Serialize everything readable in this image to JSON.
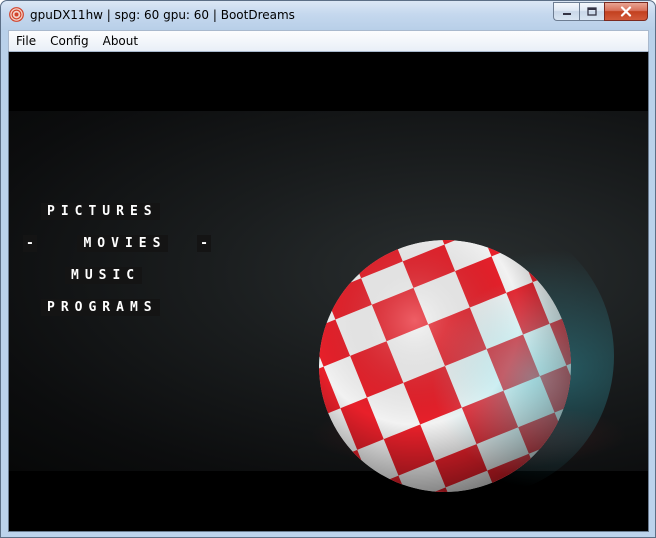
{
  "window": {
    "title": "gpuDX11hw | spg: 60 gpu: 60 | BootDreams",
    "icon": "app-swirl-icon",
    "controls": {
      "minimize_icon": "minimize-icon",
      "maximize_icon": "maximize-icon",
      "close_icon": "close-icon"
    }
  },
  "menubar": {
    "items": [
      {
        "label": "File"
      },
      {
        "label": "Config"
      },
      {
        "label": "About"
      }
    ]
  },
  "game_menu": {
    "options": [
      {
        "label": "PICTURES",
        "selected": false
      },
      {
        "label": "MOVIES",
        "selected": true,
        "marker_left": "-",
        "marker_right": "-"
      },
      {
        "label": "MUSIC",
        "selected": false
      },
      {
        "label": "PROGRAMS",
        "selected": false
      }
    ]
  },
  "scene": {
    "object": "checkered-ball",
    "colors": {
      "check_a": "#e8202a",
      "check_b": "#f2f2f2",
      "background": "#141617"
    }
  }
}
